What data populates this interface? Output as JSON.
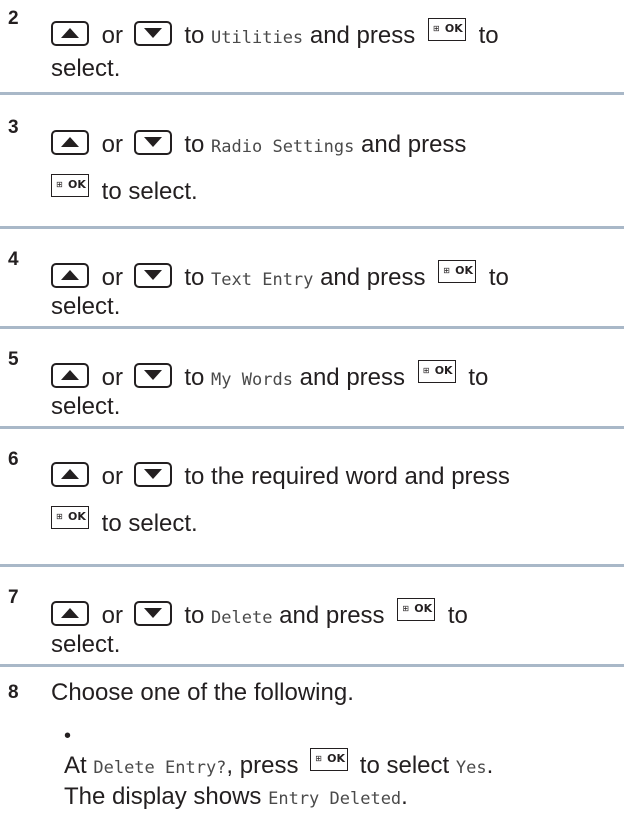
{
  "steps": [
    {
      "num": "2",
      "or": "or",
      "pre": "to",
      "target": "Utilities",
      "post": "and press",
      "tail": "to",
      "line2": "select."
    },
    {
      "num": "3",
      "or": "or",
      "pre": "to",
      "target": "Radio Settings",
      "post": "and press",
      "line2": "to select."
    },
    {
      "num": "4",
      "or": "or",
      "pre": "to",
      "target": "Text Entry",
      "post": "and press",
      "tail": "to",
      "line2": "select."
    },
    {
      "num": "5",
      "or": "or",
      "pre": "to",
      "target": "My Words",
      "post": "and press",
      "tail": "to",
      "line2": "select."
    },
    {
      "num": "6",
      "or": "or",
      "text": "to the required word and press",
      "line2": "to select."
    },
    {
      "num": "7",
      "or": "or",
      "pre": "to",
      "target": "Delete",
      "post": "and press",
      "tail": "to",
      "line2": "select."
    },
    {
      "num": "8",
      "text": "Choose one of the following."
    }
  ],
  "bullet": {
    "mark": "•",
    "at": "At",
    "prompt": "Delete Entry?",
    "press": ", press",
    "select": "to select",
    "yes": "Yes",
    "period": ".",
    "display": "The display shows",
    "result": "Entry Deleted",
    "period2": "."
  },
  "icons": {
    "up": "up-arrow-key-icon",
    "down": "down-arrow-key-icon",
    "ok": "menu-ok-key-icon",
    "ok_label": "OK"
  },
  "colors": {
    "text": "#231f20",
    "divider": "#a9b8c8",
    "mono": "#4a4a4a"
  }
}
